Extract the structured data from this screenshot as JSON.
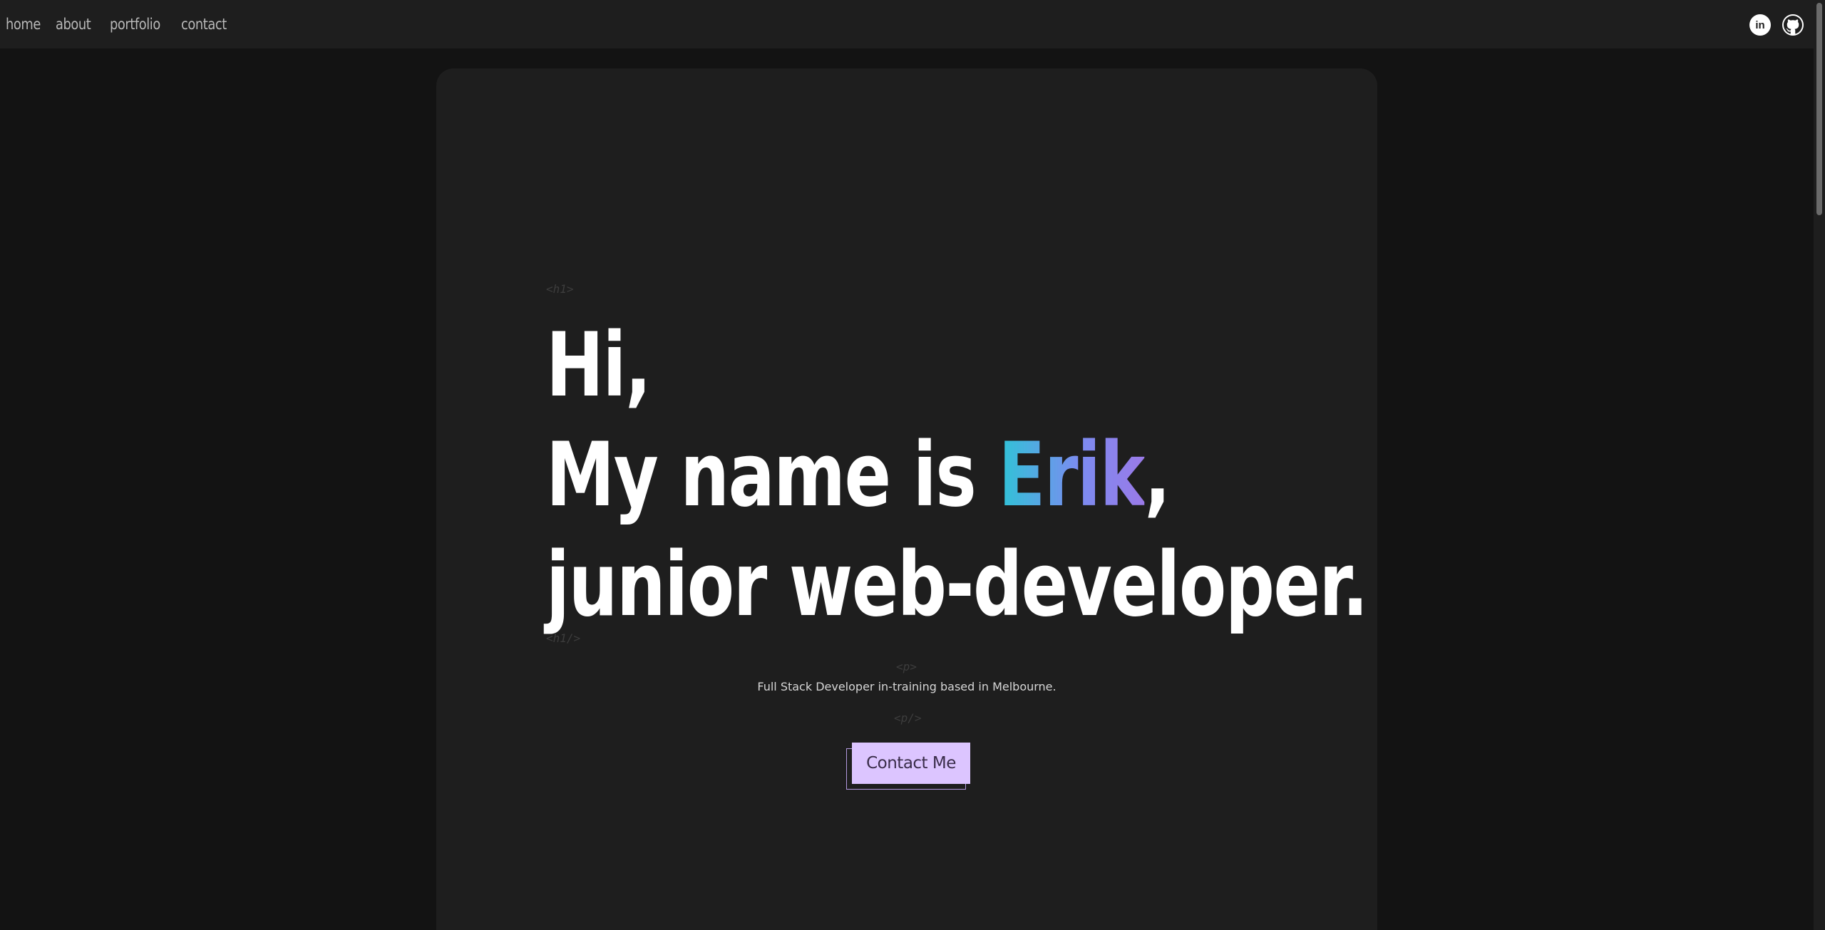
{
  "nav": {
    "links": [
      "home",
      "about",
      "portfolio",
      "contact"
    ]
  },
  "social": {
    "icons": [
      "linkedin-icon",
      "github-icon"
    ],
    "linkedin_glyph": "in"
  },
  "hero": {
    "tag_h1_open": "<h1>",
    "tag_h1_close": "<h1/>",
    "line1": "Hi,",
    "line2_prefix": "My name is ",
    "line2_name": "Erik",
    "line2_suffix": ",",
    "line3": "junior web-developer.",
    "tag_p_open": "<p>",
    "subtitle": "Full Stack Developer in-training based in Melbourne.",
    "tag_p_close": "<p/>",
    "contact_label": "Contact Me"
  },
  "colors": {
    "background": "#131313",
    "card": "#1e1e1e",
    "accent_gradient": [
      "#2ec4d6",
      "#7b8cf0",
      "#9a7ae8"
    ],
    "button": "#dcc5ff"
  }
}
